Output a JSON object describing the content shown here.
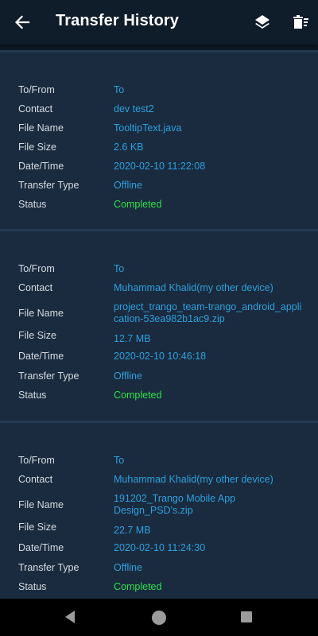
{
  "header": {
    "title": "Transfer History",
    "icons": {
      "back": "arrow-left-icon",
      "layers": "layers-icon",
      "clear": "clear-history-icon"
    }
  },
  "labels": {
    "to_from": "To/From",
    "contact": "Contact",
    "file_name": "File Name",
    "file_size": "File Size",
    "date_time": "Date/Time",
    "transfer_type": "Transfer Type",
    "status": "Status"
  },
  "transfers": [
    {
      "to_from": "To",
      "contact": "dev test2",
      "file_name": "TooltipText.java",
      "file_size": "2.6 KB",
      "date_time": "2020-02-10 11:22:08",
      "transfer_type": "Offline",
      "status": "Completed"
    },
    {
      "to_from": "To",
      "contact": "Muhammad Khalid(my other device)",
      "file_name": "project_trango_team-trango_android_application-53ea982b1ac9.zip",
      "file_size": "12.7 MB",
      "date_time": "2020-02-10 10:46:18",
      "transfer_type": "Offline",
      "status": "Completed"
    },
    {
      "to_from": "To",
      "contact": "Muhammad Khalid(my other device)",
      "file_name": "191202_Trango Mobile App Design_PSD's.zip",
      "file_size": "22.7 MB",
      "date_time": "2020-02-10 11:24:30",
      "transfer_type": "Offline",
      "status": "Completed"
    }
  ],
  "colors": {
    "background": "#0e1a26",
    "card": "#1a2b3f",
    "value": "#2f9fdc",
    "status_completed": "#2fe04a",
    "label": "#d6dbe1"
  },
  "navbar": {
    "icons": [
      "nav-back-icon",
      "nav-home-icon",
      "nav-recents-icon"
    ]
  }
}
